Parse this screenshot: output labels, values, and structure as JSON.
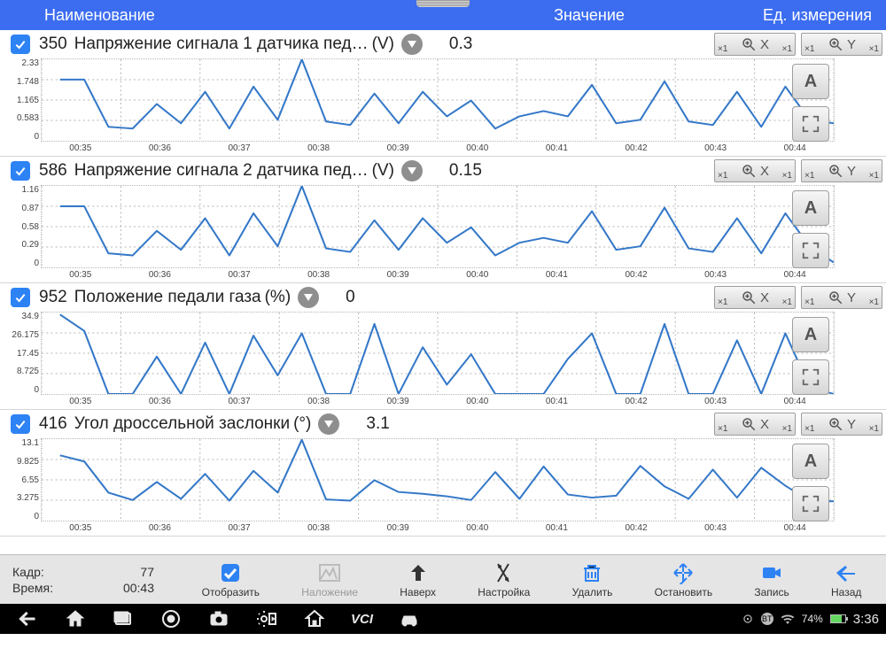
{
  "header": {
    "name": "Наименование",
    "value": "Значение",
    "unit": "Ед. измерения"
  },
  "zoom": {
    "sub": "×1",
    "x": "X",
    "y": "Y"
  },
  "sidebtn_a": "A",
  "charts": [
    {
      "pid": "350",
      "name": "Напряжение сигнала 1 датчика пед…",
      "unit": "(V)",
      "value": "0.3"
    },
    {
      "pid": "586",
      "name": "Напряжение сигнала 2 датчика пед…",
      "unit": "(V)",
      "value": "0.15"
    },
    {
      "pid": "952",
      "name": "Положение педали газа",
      "unit": "(%)",
      "value": "0"
    },
    {
      "pid": "416",
      "name": "Угол дроссельной заслонки",
      "unit": "(°)",
      "value": "3.1"
    }
  ],
  "chart_data": [
    {
      "type": "line",
      "title": "Напряжение сигнала 1 датчика пед… (V)",
      "ylabel": "",
      "xlabel": "",
      "ylim": [
        0,
        2.33
      ],
      "yticks": [
        0,
        0.583,
        1.165,
        1.748,
        2.33
      ],
      "x": [
        "00:35",
        "00:36",
        "00:37",
        "00:38",
        "00:39",
        "00:40",
        "00:41",
        "00:42",
        "00:43",
        "00:44"
      ],
      "values": [
        1.75,
        1.75,
        0.4,
        0.35,
        1.05,
        0.5,
        1.4,
        0.35,
        1.55,
        0.6,
        2.33,
        0.55,
        0.45,
        1.35,
        0.5,
        1.4,
        0.7,
        1.15,
        0.35,
        0.7,
        0.85,
        0.7,
        1.6,
        0.5,
        0.6,
        1.7,
        0.55,
        0.45,
        1.4,
        0.4,
        1.55,
        0.6,
        0.5
      ]
    },
    {
      "type": "line",
      "title": "Напряжение сигнала 2 датчика пед… (V)",
      "ylim": [
        0,
        1.16
      ],
      "yticks": [
        0,
        0.29,
        0.58,
        0.87,
        1.16
      ],
      "x": [
        "00:35",
        "00:36",
        "00:37",
        "00:38",
        "00:39",
        "00:40",
        "00:41",
        "00:42",
        "00:43",
        "00:44"
      ],
      "values": [
        0.87,
        0.87,
        0.2,
        0.17,
        0.52,
        0.25,
        0.7,
        0.17,
        0.77,
        0.3,
        1.16,
        0.27,
        0.22,
        0.67,
        0.25,
        0.7,
        0.35,
        0.57,
        0.17,
        0.35,
        0.42,
        0.35,
        0.8,
        0.25,
        0.3,
        0.85,
        0.27,
        0.22,
        0.7,
        0.2,
        0.77,
        0.3,
        0.07
      ]
    },
    {
      "type": "line",
      "title": "Положение педали газа (%)",
      "ylim": [
        0,
        34.9
      ],
      "yticks": [
        0,
        8.725,
        17.45,
        26.175,
        34.9
      ],
      "x": [
        "00:35",
        "00:36",
        "00:37",
        "00:38",
        "00:39",
        "00:40",
        "00:41",
        "00:42",
        "00:43",
        "00:44"
      ],
      "values": [
        34,
        27,
        0,
        0,
        16,
        0,
        22,
        0,
        25,
        8,
        26,
        0,
        0,
        30,
        0,
        20,
        4,
        17,
        0,
        0,
        0,
        15,
        26,
        0,
        0,
        30,
        0,
        0,
        23,
        0,
        26,
        3,
        0
      ]
    },
    {
      "type": "line",
      "title": "Угол дроссельной заслонки (°)",
      "ylim": [
        0,
        13.1
      ],
      "yticks": [
        0,
        3.275,
        6.55,
        9.825,
        13.1
      ],
      "x": [
        "00:35",
        "00:36",
        "00:37",
        "00:38",
        "00:39",
        "00:40",
        "00:41",
        "00:42",
        "00:43",
        "00:44"
      ],
      "values": [
        10.5,
        9.5,
        4.5,
        3.3,
        6.2,
        3.5,
        7.5,
        3.2,
        8.0,
        4.5,
        13.0,
        3.4,
        3.2,
        6.5,
        4.6,
        4.3,
        3.9,
        3.3,
        7.8,
        3.5,
        8.7,
        4.2,
        3.7,
        4.0,
        8.8,
        5.5,
        3.5,
        8.2,
        3.7,
        8.5,
        5.6,
        3.2,
        3.1
      ]
    }
  ],
  "footer": {
    "frame_label": "Кадр:",
    "frame_value": "77",
    "time_label": "Время:",
    "time_value": "00:43",
    "buttons": [
      {
        "id": "show",
        "label": "Отобразить",
        "color": "#2d82f4"
      },
      {
        "id": "overlay",
        "label": "Наложение",
        "disabled": true
      },
      {
        "id": "top",
        "label": "Наверх"
      },
      {
        "id": "settings",
        "label": "Настройка"
      },
      {
        "id": "delete",
        "label": "Удалить",
        "color": "#2d82f4"
      },
      {
        "id": "stop",
        "label": "Остановить",
        "color": "#2d82f4"
      },
      {
        "id": "record",
        "label": "Запись",
        "color": "#2d82f4"
      },
      {
        "id": "back",
        "label": "Назад",
        "color": "#2d82f4"
      }
    ]
  },
  "statusbar": {
    "battery": "74%",
    "clock": "3:36",
    "vci": "VCI"
  }
}
